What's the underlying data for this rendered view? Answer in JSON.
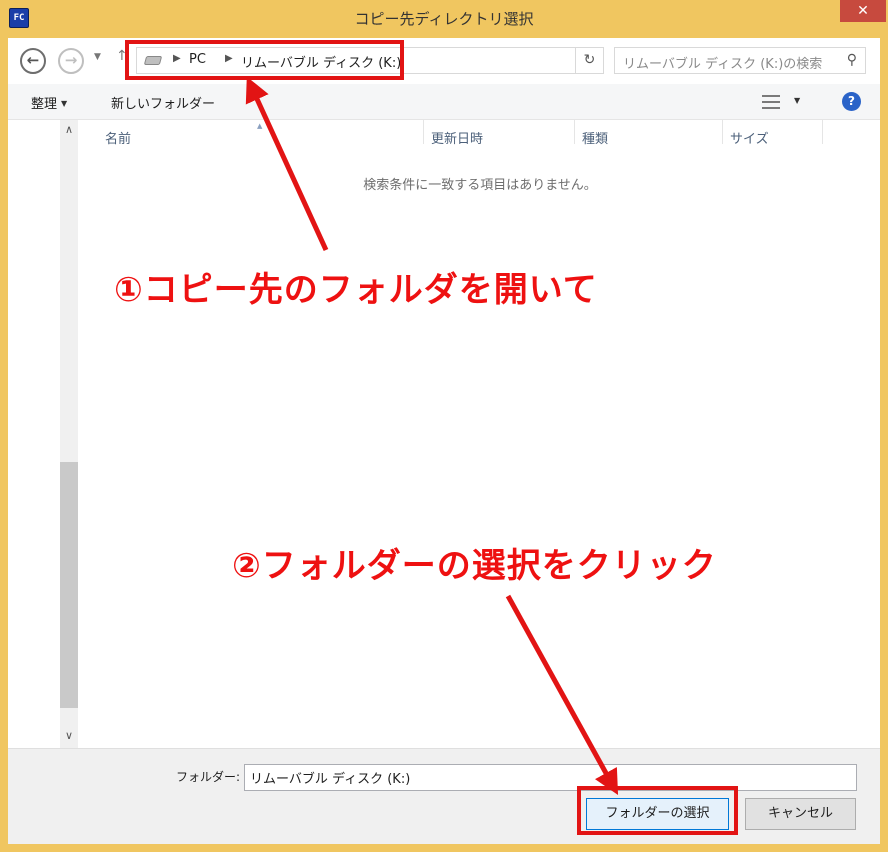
{
  "window": {
    "title": "コピー先ディレクトリ選択",
    "app_icon_label": "FC",
    "close_glyph": "✕"
  },
  "nav": {
    "back_glyph": "←",
    "forward_glyph": "→",
    "recent_glyph": "▼",
    "up_glyph": "↑",
    "breadcrumbs": [
      "PC",
      "リムーバブル ディスク (K:)"
    ],
    "crumb_arrow": "▶",
    "dropdown_glyph": "∨",
    "refresh_glyph": "↻",
    "search_placeholder": "リムーバブル ディスク (K:)の検索",
    "search_glyph": "⚲"
  },
  "toolbar": {
    "organize_label": "整理",
    "caret": "▼",
    "new_folder_label": "新しいフォルダー",
    "help_glyph": "?"
  },
  "columns": [
    "名前",
    "更新日時",
    "種類",
    "サイズ"
  ],
  "content": {
    "empty_message": "検索条件に一致する項目はありません。",
    "scroll_up_glyph": "∧",
    "scroll_down_glyph": "∨",
    "sort_glyph": "▲"
  },
  "footer": {
    "folder_label": "フォルダー:",
    "folder_value": "リムーバブル ディスク (K:)",
    "select_button": "フォルダーの選択",
    "cancel_button": "キャンセル"
  },
  "annotations": {
    "step1": "①コピー先のフォルダを開いて",
    "step2": "②フォルダーの選択をクリック",
    "color": "#e21414"
  }
}
